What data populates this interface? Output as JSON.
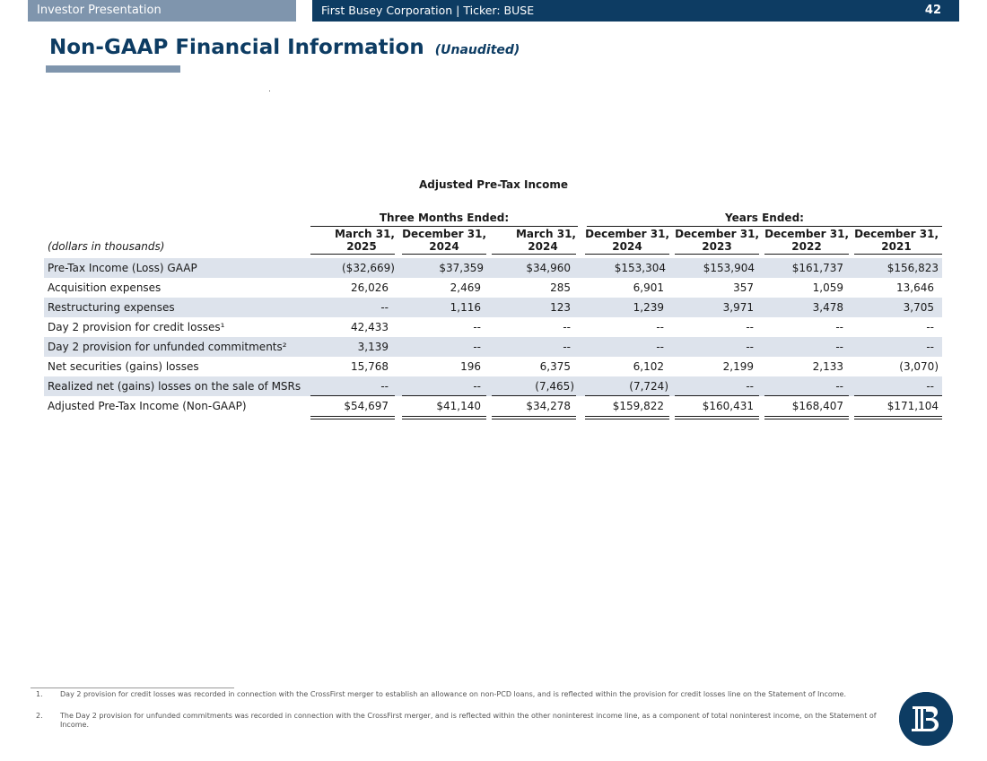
{
  "header": {
    "left_label": "Investor Presentation",
    "company": "First Busey Corporation  |  Ticker: BUSE",
    "page_number": "42"
  },
  "title": {
    "main": "Non-GAAP Financial Information",
    "sub": "(Unaudited)"
  },
  "table": {
    "title": "Adjusted Pre-Tax Income",
    "units_label": "(dollars in thousands)",
    "groups": [
      "Three Months Ended:",
      "Years Ended:"
    ],
    "columns": [
      {
        "line1": "March 31,",
        "line2": "2025"
      },
      {
        "line1": "December 31,",
        "line2": "2024"
      },
      {
        "line1": "March 31,",
        "line2": "2024"
      },
      {
        "line1": "December 31,",
        "line2": "2024"
      },
      {
        "line1": "December 31,",
        "line2": "2023"
      },
      {
        "line1": "December 31,",
        "line2": "2022"
      },
      {
        "line1": "December 31,",
        "line2": "2021"
      }
    ],
    "rows": [
      {
        "label": "Pre-Tax Income (Loss) GAAP",
        "values": [
          "($32,669)",
          "$37,359",
          "$34,960",
          "$153,304",
          "$153,904",
          "$161,737",
          "$156,823"
        ]
      },
      {
        "label": "Acquisition expenses",
        "values": [
          "26,026",
          "2,469",
          "285",
          "6,901",
          "357",
          "1,059",
          "13,646"
        ]
      },
      {
        "label": "Restructuring expenses",
        "values": [
          "--",
          "1,116",
          "123",
          "1,239",
          "3,971",
          "3,478",
          "3,705"
        ]
      },
      {
        "label": "Day 2 provision for credit losses¹",
        "values": [
          "42,433",
          "--",
          "--",
          "--",
          "--",
          "--",
          "--"
        ]
      },
      {
        "label": "Day 2 provision for unfunded commitments²",
        "values": [
          "3,139",
          "--",
          "--",
          "--",
          "--",
          "--",
          "--"
        ]
      },
      {
        "label": "Net securities (gains) losses",
        "values": [
          "15,768",
          "196",
          "6,375",
          "6,102",
          "2,199",
          "2,133",
          "(3,070)"
        ]
      },
      {
        "label": "Realized net (gains) losses on the sale of MSRs",
        "values": [
          "--",
          "--",
          "(7,465)",
          "(7,724)",
          "--",
          "--",
          "--"
        ]
      },
      {
        "label": "Adjusted Pre-Tax Income (Non-GAAP)",
        "values": [
          "$54,697",
          "$41,140",
          "$34,278",
          "$159,822",
          "$160,431",
          "$168,407",
          "$171,104"
        ]
      }
    ]
  },
  "footnotes": [
    {
      "num": "1.",
      "text": "Day 2 provision for credit losses was recorded in connection with the CrossFirst merger to establish an allowance on non-PCD loans, and is reflected within the provision for credit losses line on the Statement of Income."
    },
    {
      "num": "2.",
      "text": "The Day 2 provision for unfunded commitments was recorded in connection with the CrossFirst merger, and is reflected within the other noninterest income line, as a component of total noninterest income, on the Statement of Income."
    }
  ],
  "logo": {
    "icon": "first-busey-logo",
    "color": "#0d3c63"
  }
}
